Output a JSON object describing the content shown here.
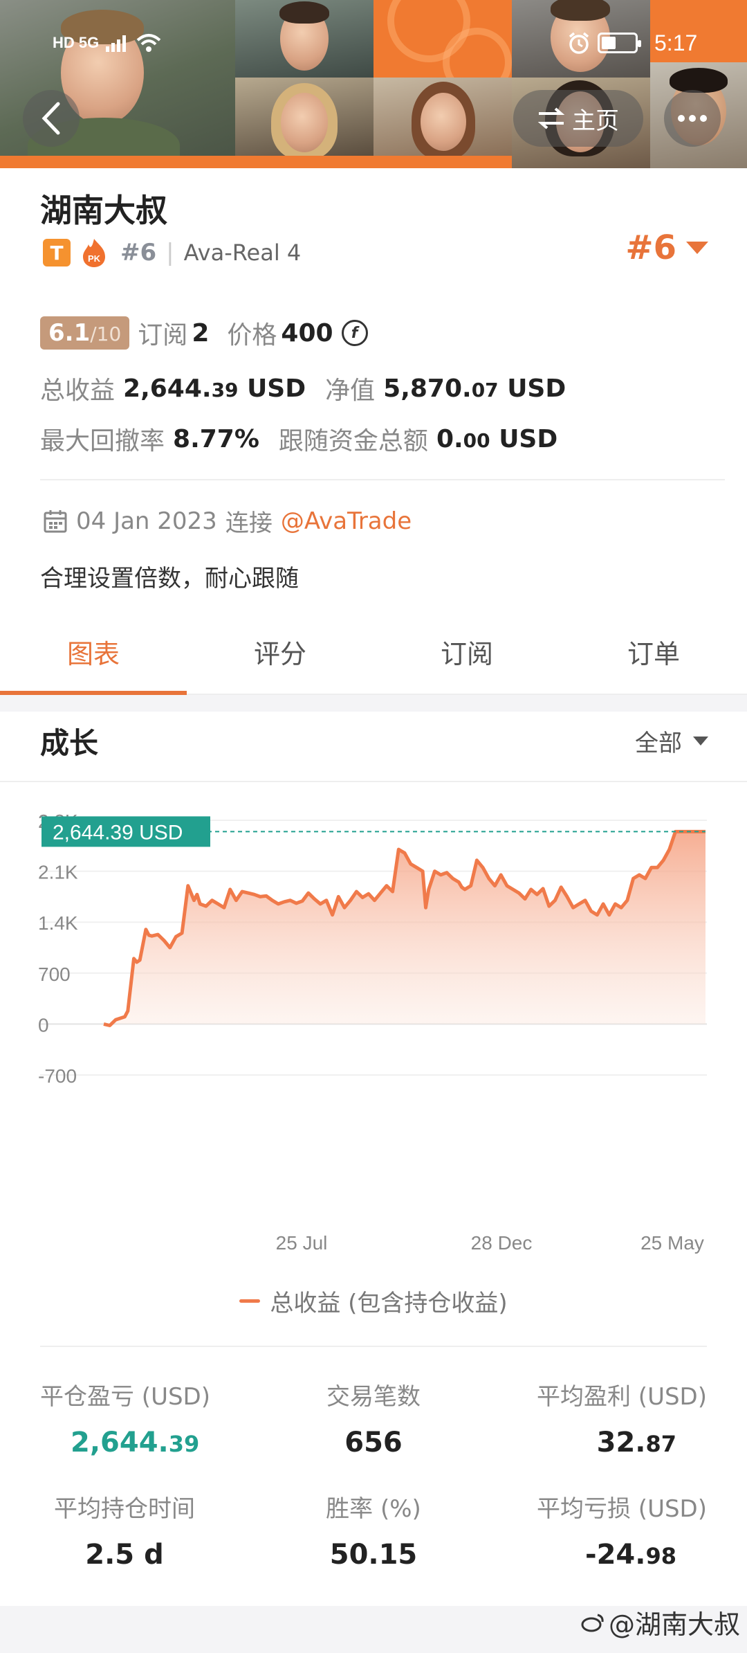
{
  "status_bar": {
    "left_indicator": "HD 5G",
    "time": "5:17"
  },
  "header": {
    "home_label": "主页"
  },
  "profile": {
    "name": "湖南大叔",
    "tag_letter": "T",
    "pk_label": "PK",
    "rank": "#6",
    "account": "Ava-Real 4",
    "rank_right": "#6"
  },
  "stats": {
    "score_main": "6.1",
    "score_sub": "/10",
    "subscribe_label": "订阅",
    "subscribe_value": "2",
    "price_label": "价格",
    "price_value": "400",
    "coin_symbol": "f",
    "total_profit_label": "总收益",
    "total_profit_main": "2,644.",
    "total_profit_dec": "39",
    "total_profit_unit": "USD",
    "equity_label": "净值",
    "equity_main": "5,870.",
    "equity_dec": "07",
    "equity_unit": "USD",
    "drawdown_label": "最大回撤率",
    "drawdown_value": "8.77%",
    "follow_label": "跟随资金总额",
    "follow_main": "0.",
    "follow_dec": "00",
    "follow_unit": "USD"
  },
  "connection": {
    "date": "04 Jan 2023",
    "connect_label": "连接",
    "broker": "@AvaTrade"
  },
  "motto": "合理设置倍数，耐心跟随",
  "tabs": [
    {
      "label": "图表",
      "active": true
    },
    {
      "label": "评分",
      "active": false
    },
    {
      "label": "订阅",
      "active": false
    },
    {
      "label": "订单",
      "active": false
    }
  ],
  "chart_section": {
    "title": "成长",
    "range_label": "全部",
    "current_value_label": "2,644.39 USD",
    "legend": "总收益 (包含持仓收益)"
  },
  "chart_data": {
    "type": "area",
    "title": "成长",
    "ylim": [
      -700,
      2800
    ],
    "y_ticks": [
      "2.8K",
      "2.1K",
      "1.4K",
      "700",
      "0",
      "-700"
    ],
    "y_tick_values": [
      2800,
      2100,
      1400,
      700,
      0,
      -700
    ],
    "x_ticks": [
      "25 Jul",
      "28 Dec",
      "25 May"
    ],
    "x_tick_positions": [
      0.3,
      0.6,
      0.9
    ],
    "series": [
      {
        "name": "总收益 (包含持仓收益)",
        "color": "#f07a4a",
        "x": [
          0,
          0.01,
          0.02,
          0.035,
          0.04,
          0.05,
          0.055,
          0.06,
          0.07,
          0.075,
          0.08,
          0.09,
          0.1,
          0.11,
          0.12,
          0.13,
          0.14,
          0.15,
          0.155,
          0.16,
          0.17,
          0.18,
          0.19,
          0.2,
          0.21,
          0.22,
          0.23,
          0.24,
          0.25,
          0.26,
          0.27,
          0.28,
          0.29,
          0.3,
          0.31,
          0.32,
          0.33,
          0.34,
          0.35,
          0.36,
          0.37,
          0.38,
          0.39,
          0.4,
          0.41,
          0.42,
          0.43,
          0.44,
          0.45,
          0.46,
          0.47,
          0.48,
          0.49,
          0.5,
          0.51,
          0.52,
          0.53,
          0.535,
          0.54,
          0.55,
          0.56,
          0.57,
          0.58,
          0.59,
          0.595,
          0.6,
          0.61,
          0.62,
          0.63,
          0.64,
          0.65,
          0.66,
          0.67,
          0.68,
          0.69,
          0.7,
          0.71,
          0.72,
          0.73,
          0.74,
          0.75,
          0.76,
          0.77,
          0.78,
          0.79,
          0.8,
          0.81,
          0.82,
          0.83,
          0.84,
          0.85,
          0.86,
          0.87,
          0.88,
          0.89,
          0.9,
          0.91,
          0.92,
          0.93,
          0.94,
          0.95,
          0.96,
          0.97,
          0.98,
          0.99,
          1.0
        ],
        "y": [
          0,
          -20,
          60,
          100,
          180,
          900,
          850,
          880,
          1300,
          1220,
          1210,
          1230,
          1150,
          1050,
          1200,
          1250,
          1900,
          1700,
          1780,
          1650,
          1620,
          1700,
          1650,
          1600,
          1850,
          1700,
          1820,
          1800,
          1780,
          1750,
          1760,
          1700,
          1650,
          1680,
          1700,
          1660,
          1690,
          1800,
          1720,
          1650,
          1700,
          1500,
          1750,
          1600,
          1700,
          1820,
          1740,
          1790,
          1700,
          1800,
          1900,
          1820,
          2400,
          2350,
          2200,
          2150,
          2100,
          1600,
          1850,
          2100,
          2050,
          2080,
          2000,
          1950,
          1880,
          1850,
          1900,
          2250,
          2150,
          2000,
          1900,
          2050,
          1900,
          1850,
          1800,
          1720,
          1850,
          1780,
          1860,
          1620,
          1700,
          1880,
          1750,
          1600,
          1650,
          1700,
          1550,
          1500,
          1650,
          1500,
          1650,
          1600,
          1700,
          2000,
          2050,
          2000,
          2150,
          2150,
          2250,
          2400,
          2644.39,
          2644.39,
          2644.39,
          2644.39,
          2644.39,
          2644.39
        ]
      }
    ]
  },
  "summary": [
    {
      "label": "平仓盈亏 (USD)",
      "main": "2,644.",
      "dec": "39",
      "green": true
    },
    {
      "label": "交易笔数",
      "main": "656",
      "dec": "",
      "green": false
    },
    {
      "label": "平均盈利 (USD)",
      "main": "32.",
      "dec": "87",
      "green": false
    },
    {
      "label": "平均持仓时间",
      "main": "2.5 d",
      "dec": "",
      "green": false
    },
    {
      "label": "胜率 (%)",
      "main": "50.15",
      "dec": "",
      "green": false
    },
    {
      "label": "平均亏损 (USD)",
      "main": "-24.",
      "dec": "98",
      "green": false
    }
  ],
  "watermark": "@湖南大叔"
}
